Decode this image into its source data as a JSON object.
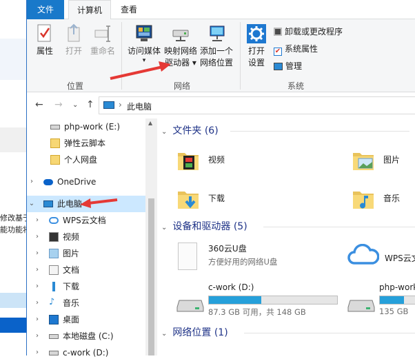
{
  "background_window": {
    "lines": [
      "修改基于",
      "能功能将"
    ]
  },
  "tabs": {
    "file": "文件",
    "computer": "计算机",
    "view": "查看"
  },
  "ribbon": {
    "location_group": {
      "label": "位置",
      "properties": "属性",
      "open": "打开",
      "rename": "重命名"
    },
    "network_group": {
      "label": "网络",
      "access_media": [
        "访问媒体",
        "▾"
      ],
      "map_drive": [
        "映射网络",
        "驱动器 ▾"
      ],
      "add_location": [
        "添加一个",
        "网络位置"
      ]
    },
    "system_group": {
      "label": "系统",
      "open_settings": [
        "打开",
        "设置"
      ],
      "uninstall": "卸载或更改程序",
      "system_properties": "系统属性",
      "manage": "管理"
    }
  },
  "address": {
    "path": "此电脑",
    "separator": "›"
  },
  "nav": {
    "items": [
      {
        "label": "php-work (E:)",
        "icon": "drive-icon"
      },
      {
        "label": "弹性云脚本",
        "icon": "folder-icon"
      },
      {
        "label": "个人网盘",
        "icon": "folder-icon"
      },
      {
        "label": "OneDrive",
        "icon": "cloud-icon"
      },
      {
        "label": "此电脑",
        "icon": "computer-icon"
      },
      {
        "label": "WPS云文档",
        "icon": "wps-cloud-icon"
      },
      {
        "label": "视频",
        "icon": "video-icon"
      },
      {
        "label": "图片",
        "icon": "picture-icon"
      },
      {
        "label": "文档",
        "icon": "document-icon"
      },
      {
        "label": "下载",
        "icon": "download-icon"
      },
      {
        "label": "音乐",
        "icon": "music-icon"
      },
      {
        "label": "桌面",
        "icon": "desktop-icon"
      },
      {
        "label": "本地磁盘 (C:)",
        "icon": "drive-icon"
      },
      {
        "label": "c-work (D:)",
        "icon": "drive-icon"
      }
    ]
  },
  "content": {
    "folders_section": "文件夹 (6)",
    "folders": [
      {
        "label": "视频",
        "icon": "video-folder-icon"
      },
      {
        "label": "图片",
        "icon": "picture-folder-icon"
      },
      {
        "label": "下载",
        "icon": "download-folder-icon"
      },
      {
        "label": "音乐",
        "icon": "music-folder-icon"
      }
    ],
    "devices_section": "设备和驱动器 (5)",
    "devices": [
      {
        "label": "360云U盘",
        "sub": "方便好用的网络U盘",
        "icon": "document-icon"
      },
      {
        "label": "WPS云文",
        "icon": "wps-cloud-icon"
      },
      {
        "label": "c-work (D:)",
        "sub": "87.3 GB 可用，共 148 GB",
        "used_fraction": 0.41,
        "icon": "drive-icon"
      },
      {
        "label": "php-work",
        "sub": "135 GB",
        "used_fraction": 0.5,
        "icon": "drive-icon"
      }
    ],
    "network_section": "网络位置 (1)"
  },
  "colors": {
    "accent": "#1979ca",
    "annotation_arrow": "#e53935",
    "drive_bar": "#26a0da"
  }
}
